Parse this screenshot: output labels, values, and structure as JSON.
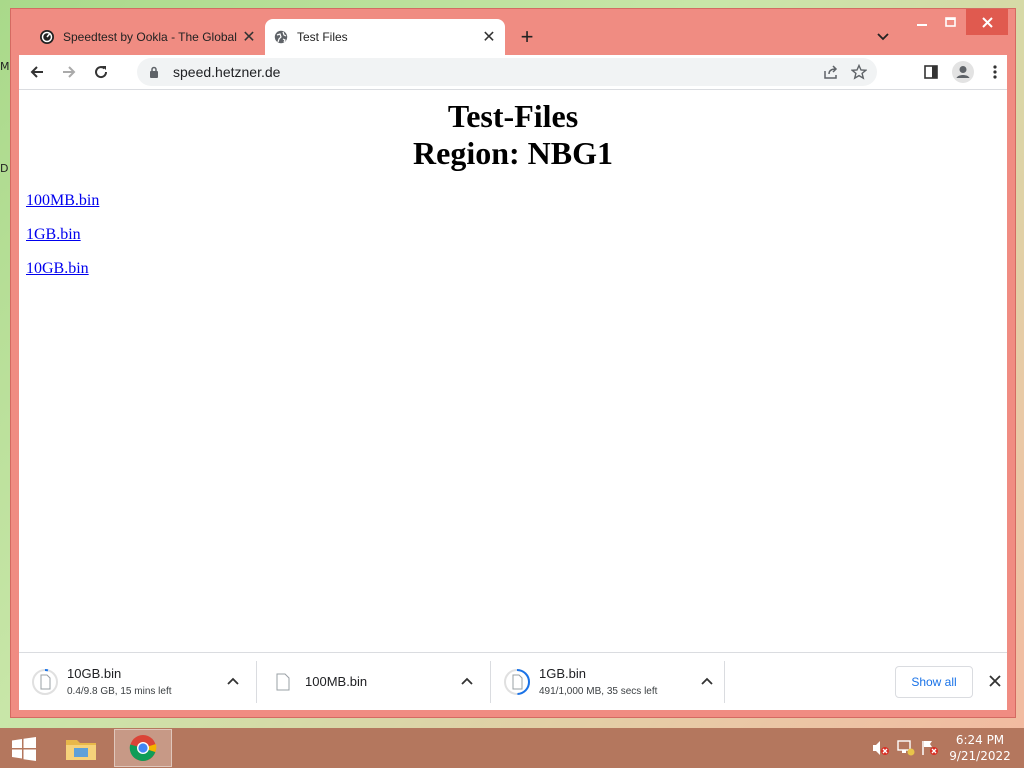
{
  "desktop": {
    "edge_labels": [
      "M",
      "D"
    ]
  },
  "browser": {
    "tabs": [
      {
        "title": "Speedtest by Ookla - The Global",
        "icon": "speedtest-icon",
        "active": false
      },
      {
        "title": "Test Files",
        "icon": "globe-icon",
        "active": true
      }
    ],
    "new_tab_label": "+",
    "address": "speed.hetzner.de",
    "accent": "#f08c82"
  },
  "page": {
    "heading_line1": "Test-Files",
    "heading_line2": "Region: NBG1",
    "links": [
      "100MB.bin",
      "1GB.bin",
      "10GB.bin"
    ]
  },
  "downloads": {
    "items": [
      {
        "name": "10GB.bin",
        "status": "0.4/9.8 GB, 15 mins left",
        "progress": 0.04
      },
      {
        "name": "100MB.bin",
        "status": "",
        "progress": 1.0
      },
      {
        "name": "1GB.bin",
        "status": "491/1,000 MB, 35 secs left",
        "progress": 0.49
      }
    ],
    "show_all_label": "Show all"
  },
  "taskbar": {
    "apps": [
      "file-explorer-icon",
      "chrome-icon"
    ],
    "time": "6:24 PM",
    "date": "9/21/2022"
  }
}
